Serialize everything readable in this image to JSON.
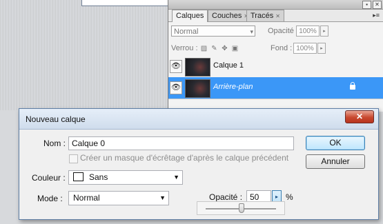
{
  "layers_panel": {
    "tabs": [
      {
        "label": "Calques",
        "active": true
      },
      {
        "label": "Couches",
        "active": false
      },
      {
        "label": "Tracés",
        "active": false
      }
    ],
    "blend_mode": "Normal",
    "opacity_label": "Opacité :",
    "opacity_value": "100%",
    "lock_label": "Verrou :",
    "fill_label": "Fond :",
    "fill_value": "100%",
    "layers": [
      {
        "name": "Calque 1",
        "selected": false,
        "visible": true,
        "locked": false
      },
      {
        "name": "Arrière-plan",
        "selected": true,
        "visible": true,
        "locked": true
      }
    ]
  },
  "dialog": {
    "title": "Nouveau calque",
    "close_glyph": "✕",
    "name_label": "Nom :",
    "name_value": "Calque 0",
    "clip_mask_label": "Créer un masque d'écrêtage d'après le calque précédent",
    "clip_mask_checked": false,
    "color_label": "Couleur :",
    "color_value": "Sans",
    "mode_label": "Mode :",
    "mode_value": "Normal",
    "opacity_label": "Opacité :",
    "opacity_value": "50",
    "opacity_unit": "%",
    "opacity_fraction": 0.5,
    "ok_label": "OK",
    "cancel_label": "Annuler"
  },
  "colors": {
    "selection": "#3b97f7",
    "dialog_border": "#5e7ea5",
    "close_button": "#c8482f"
  }
}
